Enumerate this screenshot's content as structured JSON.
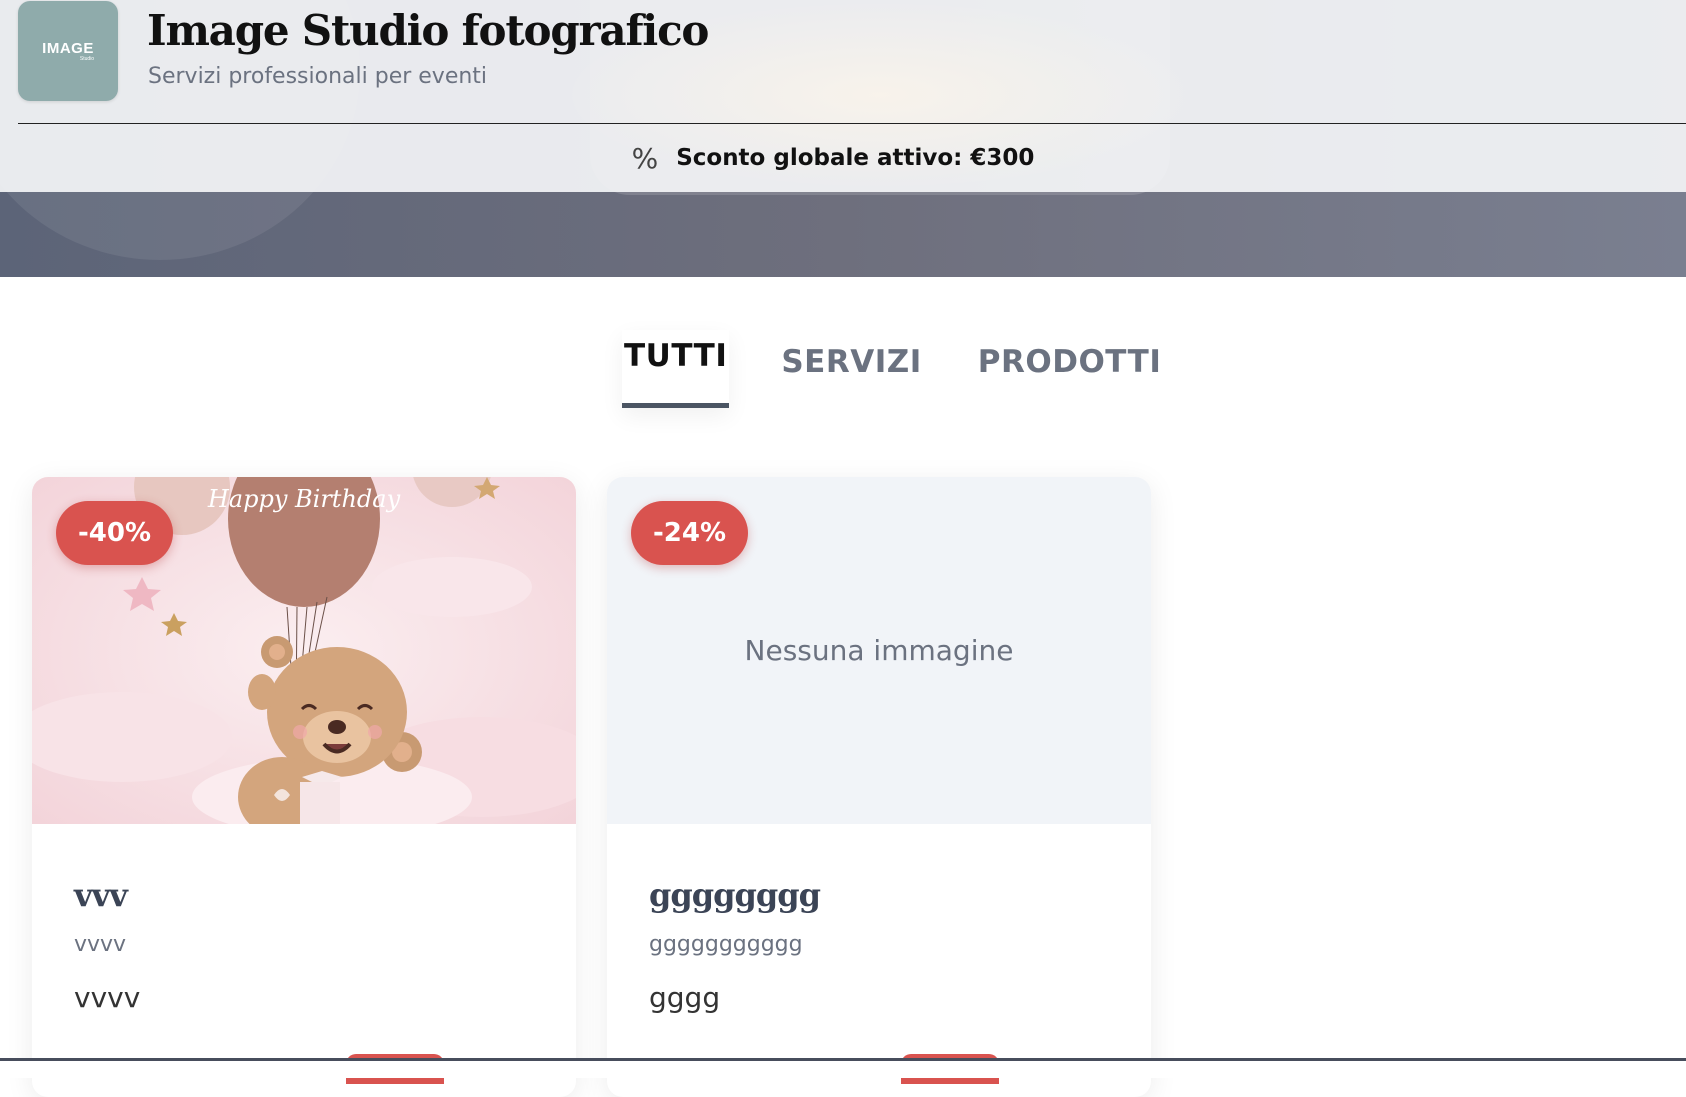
{
  "header": {
    "logo_text": "IMAGE",
    "logo_subtext": "Studio",
    "title": "Image Studio fotografico",
    "subtitle": "Servizi professionali per eventi"
  },
  "discount_bar": {
    "icon": "percent-icon",
    "icon_glyph": "%",
    "text": "Sconto globale attivo: €300"
  },
  "tabs": [
    {
      "label": "TUTTI",
      "active": true
    },
    {
      "label": "SERVIZI",
      "active": false
    },
    {
      "label": "PRODOTTI",
      "active": false
    }
  ],
  "cards": [
    {
      "badge": "-40%",
      "image_text": "Happy Birthday",
      "title": "vvv",
      "description": "vvvv",
      "price": "vvvv"
    },
    {
      "badge": "-24%",
      "image_placeholder": "Nessuna immagine",
      "title": "gggggggg",
      "description": "ggggggggggg",
      "price": "gggg"
    }
  ],
  "colors": {
    "badge": "#d9534f",
    "logo_bg": "#8fabab",
    "hero": "#5c6478",
    "tab_indicator": "#4b5563"
  }
}
